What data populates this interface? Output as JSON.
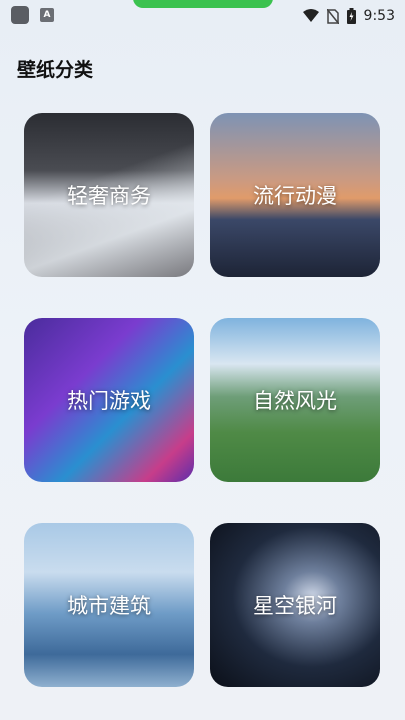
{
  "status_bar": {
    "a_icon_letter": "A",
    "time": "9:53"
  },
  "page": {
    "title": "壁纸分类"
  },
  "categories": [
    {
      "label": "轻奢商务"
    },
    {
      "label": "流行动漫"
    },
    {
      "label": "热门游戏"
    },
    {
      "label": "自然风光"
    },
    {
      "label": "城市建筑"
    },
    {
      "label": "星空银河"
    }
  ]
}
